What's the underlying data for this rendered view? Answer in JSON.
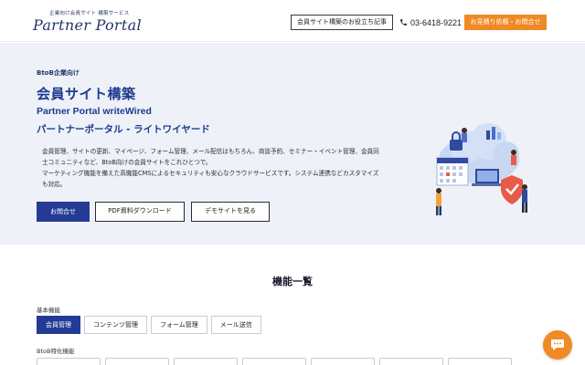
{
  "header": {
    "logo_tagline": "企業向け会員サイト 構築サービス",
    "logo_text": "Partner Portal",
    "blog_button": "会員サイト構築のお役立ち記事",
    "phone": "03-6418-9221",
    "cta_button": "お見積り依頼・お問合せ",
    "colors": {
      "cta": "#f08a24",
      "brand": "#243469"
    }
  },
  "hero": {
    "eyebrow": "BtoB企業向け",
    "title": "会員サイト構築",
    "subtitle_en": "Partner Portal writeWired",
    "subtitle_ja": "パートナーポータル - ライトワイヤード",
    "description": [
      "会員管理、サイトの更新、マイページ、フォーム管理、メール配信はもちろん、商談予約、セミナー・イベント管理、会員同",
      "士コミュニティなど、BtoB向けの会員サイトをこれひとつで。",
      "マーケティング機能を備えた高機能CMSによるセキュリティも安心なクラウドサービスです。システム連携などカスタマイズ",
      "も対応。"
    ],
    "buttons": {
      "contact": "お問合せ",
      "pdf": "PDF資料ダウンロード",
      "demo": "デモサイトを見る"
    },
    "illustration_icon": "cloud-security-illustration"
  },
  "features": {
    "title": "機能一覧",
    "basic_label": "基本機能",
    "basic_tabs": [
      "会員管理",
      "コンテンツ管理",
      "フォーム管理",
      "メール送信"
    ],
    "active_tab": "会員管理",
    "btob_label": "BtoB特化機能",
    "colors": {
      "active": "#233b94"
    }
  },
  "chat": {
    "icon": "chat-icon"
  }
}
